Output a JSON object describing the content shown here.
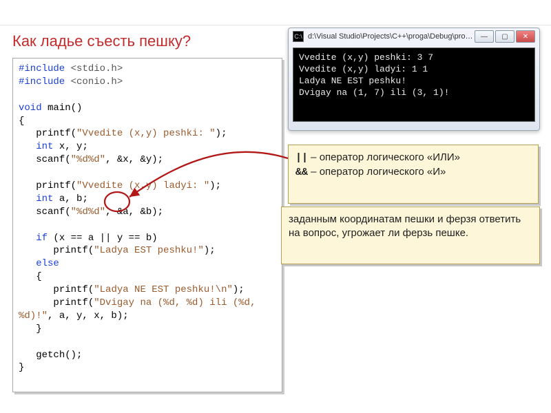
{
  "slide": {
    "title": "Как ладье съесть пешку?"
  },
  "code": {
    "line1a": "#include",
    "line1b": " <stdio.h>",
    "line2a": "#include",
    "line2b": " <conio.h>",
    "blank": "",
    "line3a": "void",
    "line3b": " main()",
    "line4": "{",
    "line5a": "   printf(",
    "line5b": "\"Vvedite (x,y) peshki: \"",
    "line5c": ");",
    "line6a": "   int",
    "line6b": " x, y;",
    "line7a": "   scanf(",
    "line7b": "\"%d%d\"",
    "line7c": ", &x, &y);",
    "line8a": "   printf(",
    "line8b": "\"Vvedite (x,y) ladyi: \"",
    "line8c": ");",
    "line9a": "   int",
    "line9b": " a, b;",
    "line10a": "   scanf(",
    "line10b": "\"%d%d\"",
    "line10c": ", &a, &b);",
    "line11a": "   if",
    "line11b": " (x == a || y == b)",
    "line12a": "      printf(",
    "line12b": "\"Ladya EST peshku!\"",
    "line12c": ");",
    "line13a": "   else",
    "line14": "   {",
    "line15a": "      printf(",
    "line15b": "\"Ladya NE EST peshku!\\n\"",
    "line15c": ");",
    "line16a": "      printf(",
    "line16b": "\"Dvigay na (%d, %d) ili (%d, %d)!\"",
    "line16c": ", a, y, x, b);",
    "line17": "   }",
    "line18": "   getch();",
    "line19": "}"
  },
  "console": {
    "title": "d:\\Visual Studio\\Projects\\C++\\proga\\Debug\\proga.exe",
    "lines": "Vvedite (x,y) peshki: 3 7\nVvedite (x,y) ladyi: 1 1\nLadya NE EST peshku!\nDvigay na (1, 7) ili (3, 1)!"
  },
  "note1": {
    "or_symbol": "||",
    "or_text": "  – оператор логического «ИЛИ»",
    "and_symbol": "&&",
    "and_text": " – оператор логического «И»"
  },
  "note2": {
    "text": "заданным координатам пешки и ферзя ответить на вопрос, угрожает ли ферзь пешке."
  },
  "icons": {
    "console": "C:\\",
    "min": "—",
    "max": "▢",
    "close": "✕"
  }
}
